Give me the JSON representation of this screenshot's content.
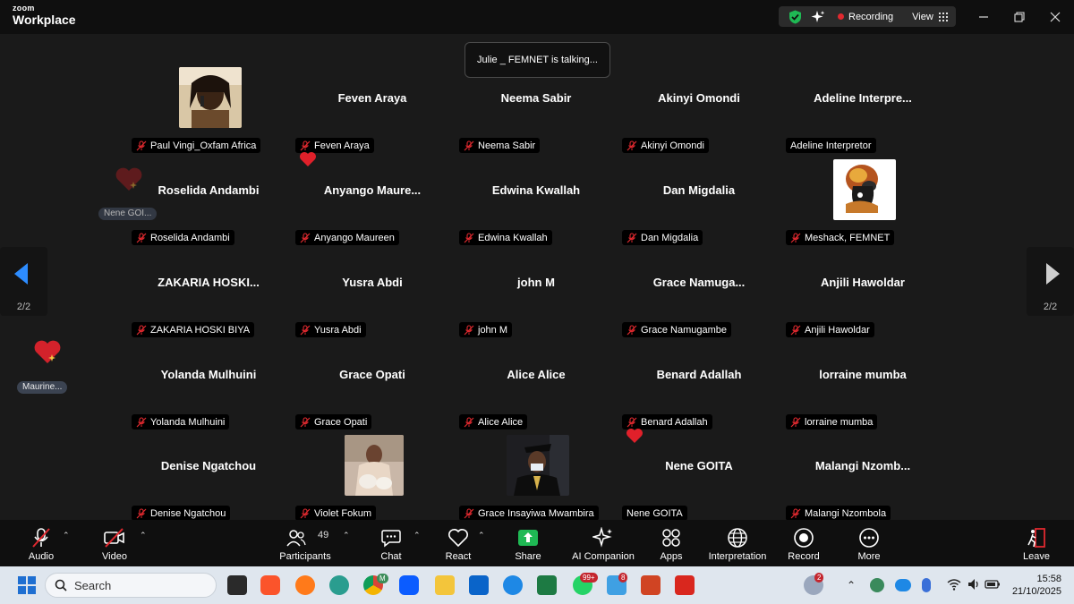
{
  "app": {
    "logo_top": "zoom",
    "logo_bottom": "Workplace"
  },
  "header": {
    "recording_label": "Recording",
    "view_label": "View"
  },
  "toast": {
    "text": "Julie _ FEMNET is talking..."
  },
  "pagination": {
    "left": "2/2",
    "right": "2/2"
  },
  "reactions": {
    "side_1_name": "Nene GOI...",
    "side_2_name": "Maurine..."
  },
  "tiles": [
    {
      "name": "",
      "label": "Paul Vingi_Oxfam Africa"
    },
    {
      "name": "Feven Araya",
      "label": "Feven Araya"
    },
    {
      "name": "Neema Sabir",
      "label": "Neema Sabir"
    },
    {
      "name": "Akinyi Omondi",
      "label": "Akinyi Omondi"
    },
    {
      "name": "Adeline  Interpre...",
      "label": "Adeline Interpretor"
    },
    {
      "name": "Roselida Andambi",
      "label": "Roselida Andambi"
    },
    {
      "name": "Anyango  Maure...",
      "label": "Anyango Maureen"
    },
    {
      "name": "Edwina Kwallah",
      "label": "Edwina Kwallah"
    },
    {
      "name": "Dan Migdalia",
      "label": "Dan Migdalia"
    },
    {
      "name": "",
      "label": "Meshack, FEMNET"
    },
    {
      "name": "ZAKARIA  HOSKI...",
      "label": "ZAKARIA HOSKI BIYA"
    },
    {
      "name": "Yusra Abdi",
      "label": "Yusra Abdi"
    },
    {
      "name": "john M",
      "label": "john M"
    },
    {
      "name": "Grace  Namuga...",
      "label": "Grace Namugambe"
    },
    {
      "name": "Anjili Hawoldar",
      "label": "Anjili Hawoldar"
    },
    {
      "name": "Yolanda Mulhuini",
      "label": "Yolanda Mulhuini"
    },
    {
      "name": "Grace Opati",
      "label": "Grace Opati"
    },
    {
      "name": "Alice Alice",
      "label": "Alice Alice"
    },
    {
      "name": "Benard Adallah",
      "label": "Benard Adallah"
    },
    {
      "name": "lorraine mumba",
      "label": "lorraine mumba"
    },
    {
      "name": "Denise Ngatchou",
      "label": "Denise Ngatchou"
    },
    {
      "name": "",
      "label": "Violet Fokum"
    },
    {
      "name": "",
      "label": "Grace Insayiwa Mwambira"
    },
    {
      "name": "Nene GOITA",
      "label": "Nene GOITA"
    },
    {
      "name": "Malangi  Nzomb...",
      "label": "Malangi Nzombola"
    }
  ],
  "toolbar": {
    "audio": "Audio",
    "video": "Video",
    "participants": "Participants",
    "participants_count": "49",
    "chat": "Chat",
    "react": "React",
    "share": "Share",
    "ai_companion": "AI Companion",
    "apps": "Apps",
    "interpretation": "Interpretation",
    "record": "Record",
    "more": "More",
    "leave": "Leave"
  },
  "taskbar": {
    "search_placeholder": "Search",
    "time": "15:58",
    "date": "21/10/2025",
    "whatsapp_badge": "99+",
    "weather_badge": "2",
    "app_badge": "8",
    "chrome_badge": "M"
  },
  "colors": {
    "accent": "#2d8cff",
    "recording": "#e0292f",
    "leave": "#e0292f",
    "share": "#1fb954",
    "shield": "#1fb954",
    "heart": "#e0202a"
  }
}
